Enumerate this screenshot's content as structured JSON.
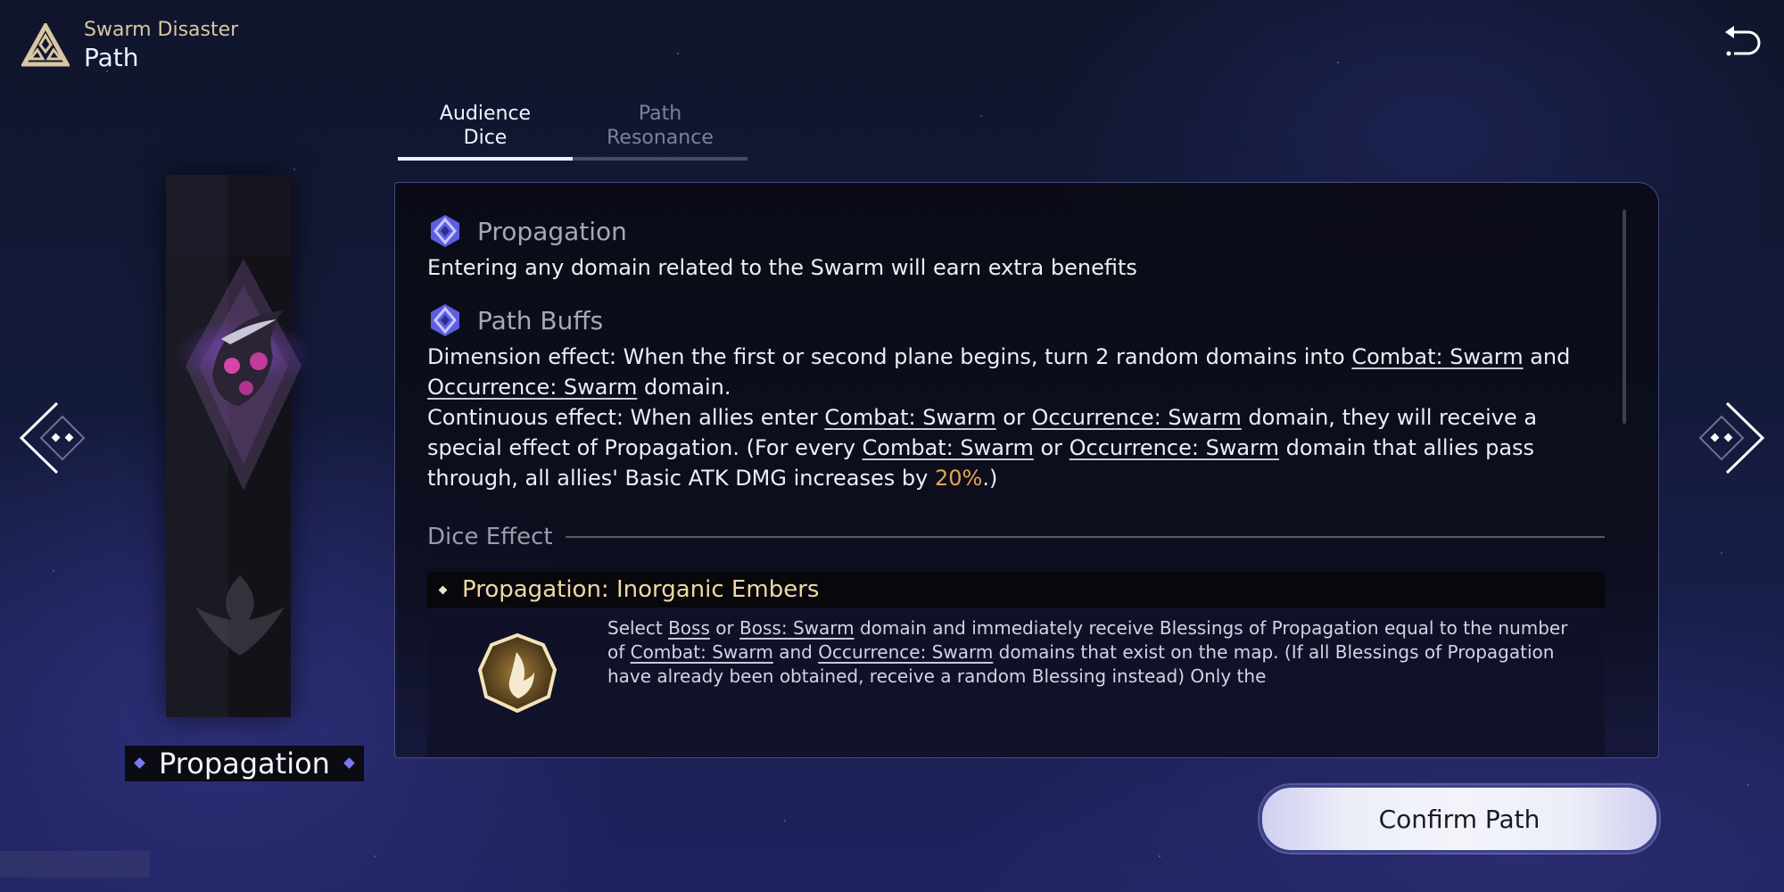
{
  "header": {
    "subtitle": "Swarm Disaster",
    "title": "Path",
    "logo_icon": "triangle-emblem-icon",
    "back_icon": "return-arrow-icon"
  },
  "tabs": [
    {
      "label_line1": "Audience",
      "label_line2": "Dice",
      "active": true
    },
    {
      "label_line1": "Path",
      "label_line2": "Resonance",
      "active": false
    }
  ],
  "card": {
    "name": "Propagation",
    "emblem_icon": "swarm-path-emblem-icon"
  },
  "nav": {
    "prev_icon": "chevron-left-icon",
    "next_icon": "chevron-right-icon"
  },
  "panel": {
    "section1": {
      "title": "Propagation",
      "text": "Entering any domain related to the Swarm will earn extra benefits"
    },
    "section2": {
      "title": "Path Buffs",
      "dimension": {
        "prefix": "Dimension effect: When the first or second plane begins, turn 2 random domains into ",
        "link1": "Combat: Swarm",
        "mid": " and ",
        "link2": "Occurrence: Swarm",
        "suffix": " domain."
      },
      "continuous": {
        "p1": "Continuous effect: When allies enter ",
        "link1": "Combat: Swarm",
        "p2": " or ",
        "link2": "Occurrence: Swarm",
        "p3": " domain, they will receive a special effect of Propagation. (For every ",
        "link3": "Combat: Swarm",
        "p4": " or ",
        "link4": "Occurrence: Swarm",
        "p5": " domain that allies pass through, all allies' Basic ATK DMG increases by ",
        "value": "20%",
        "p6": ".)"
      }
    },
    "dice_effect": {
      "heading": "Dice Effect",
      "name": "Propagation: Inorganic Embers",
      "icon": "flame-icon",
      "desc": {
        "p1": "Select ",
        "link1": "Boss",
        "p2": " or ",
        "link2": "Boss: Swarm",
        "p3": " domain and immediately receive Blessings of Propagation equal to the number of ",
        "link3": "Combat: Swarm",
        "p4": " and ",
        "link4": "Occurrence: Swarm",
        "p5": " domains that exist on the map. (If all Blessings of Propagation have already been obtained, receive a random Blessing instead) Only the"
      }
    }
  },
  "confirm_button": "Confirm Path",
  "colors": {
    "accent_gold": "#d9c6a2",
    "highlight_orange": "#e8a54c",
    "icon_purple": "#6f6ff0",
    "effect_title": "#f1d8a2"
  }
}
